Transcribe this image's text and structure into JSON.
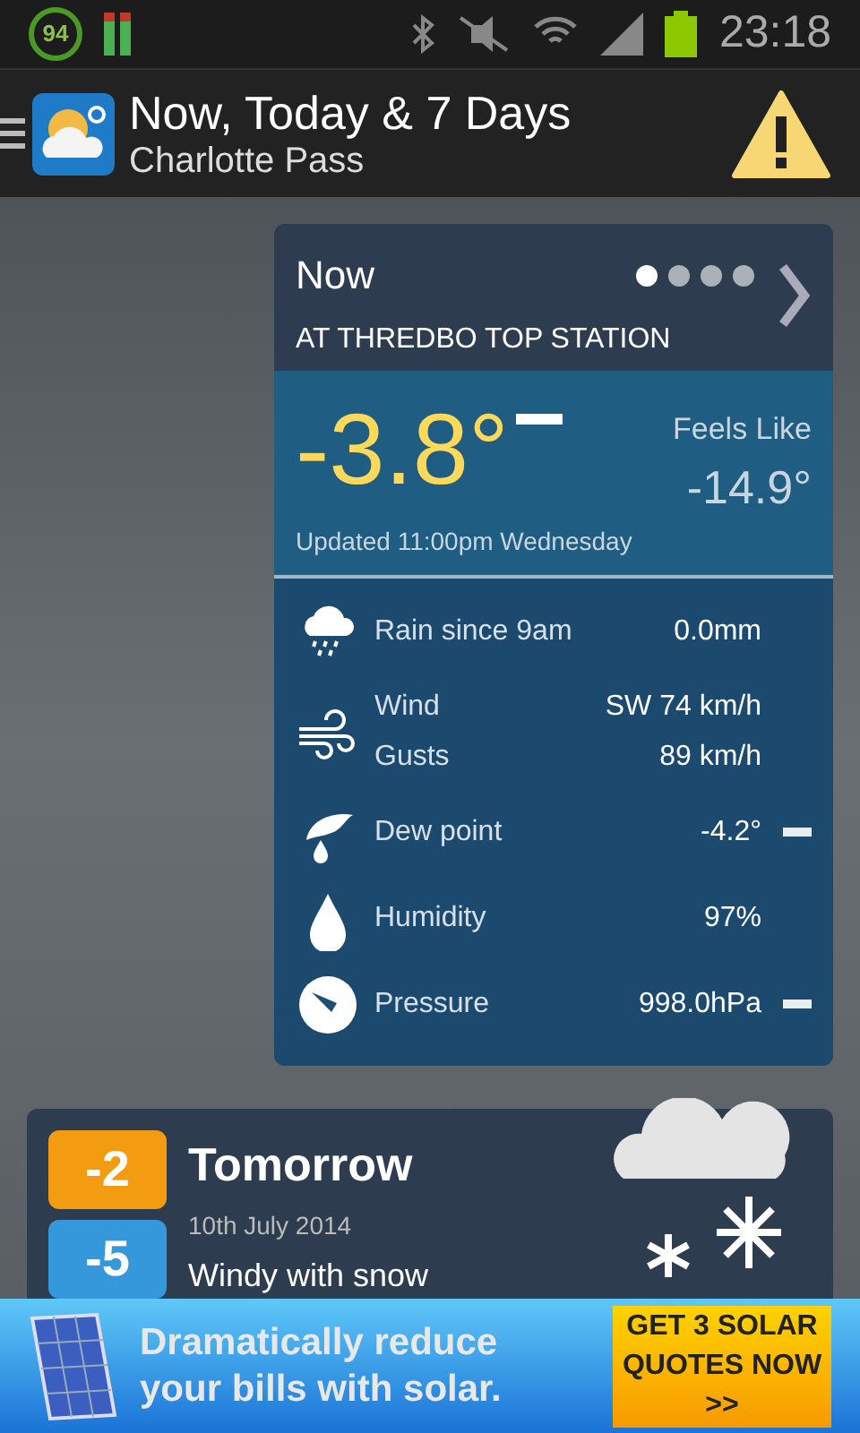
{
  "status_bar": {
    "badge": "94",
    "time": "23:18"
  },
  "app_bar": {
    "title": "Now, Today & 7 Days",
    "subtitle": "Charlotte Pass"
  },
  "now_card": {
    "title": "Now",
    "station": "AT THREDBO TOP STATION",
    "pages": [
      {
        "selected": true
      },
      {
        "selected": false
      },
      {
        "selected": false
      },
      {
        "selected": false
      }
    ],
    "temperature": "-3.8°",
    "temperature_trend": true,
    "feels_like_label": "Feels Like",
    "feels_like": "-14.9°",
    "updated": "Updated 11:00pm Wednesday",
    "rows": [
      {
        "kind": "rain",
        "label": "Rain since 9am",
        "value": "0.0mm",
        "trend": false
      },
      {
        "kind": "wind",
        "label": "Wind",
        "value": "SW 74 km/h",
        "label_2": "Gusts",
        "value_2": "89 km/h",
        "trend": false
      },
      {
        "kind": "dew",
        "label": "Dew point",
        "value": "-4.2°",
        "trend": true
      },
      {
        "kind": "humidity",
        "label": "Humidity",
        "value": "97%",
        "trend": false
      },
      {
        "kind": "pressure",
        "label": "Pressure",
        "value": "998.0hPa",
        "trend": true
      }
    ]
  },
  "forecast": {
    "day": "Tomorrow",
    "date": "10th July 2014",
    "summary": "Windy with snow",
    "temps": [
      {
        "value": "-2",
        "color": "#f39c12"
      },
      {
        "value": "-5",
        "color": "#3498db"
      }
    ]
  },
  "ad": {
    "text": "Dramatically reduce your bills with solar.",
    "button": "GET 3 SOLAR QUOTES NOW >>"
  }
}
